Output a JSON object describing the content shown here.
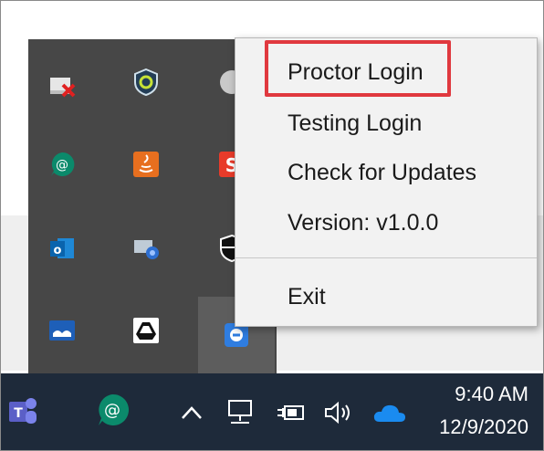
{
  "context_menu": {
    "items": [
      "Proctor Login",
      "Testing Login",
      "Check for Updates",
      "Version: v1.0.0"
    ],
    "exit_label": "Exit",
    "highlighted_item": "Proctor Login",
    "highlight_color": "#e0393f"
  },
  "tray_flyout": {
    "icons": [
      "network-error-icon",
      "shield-icon",
      "app-icon",
      "chat-at-icon",
      "java-icon",
      "snip-icon",
      "outlook-icon",
      "display-settings-icon",
      "security-shield-icon",
      "reader-icon",
      "drive-icon",
      "proctor-app-icon"
    ]
  },
  "taskbar": {
    "background": "#1e2a3a",
    "time": "9:40 AM",
    "date": "12/9/2020",
    "icons": [
      "teams-icon",
      "chat-at-icon",
      "chevron-up-icon",
      "network-icon",
      "battery-icon",
      "volume-icon",
      "onedrive-icon"
    ]
  }
}
